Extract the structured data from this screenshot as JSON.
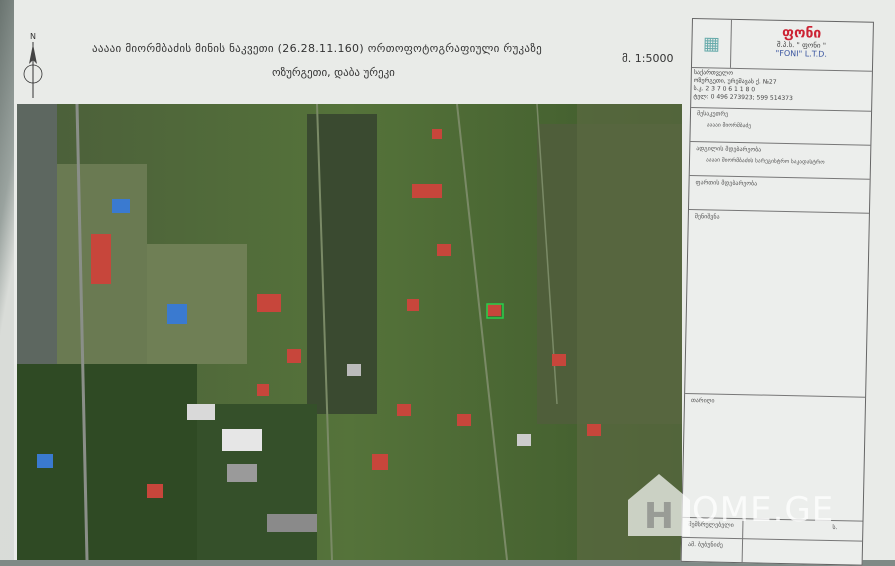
{
  "document": {
    "title": "ააააი მიორმბაძის მინის ნაკვეთი (26.28.11.160) ორთოფოტოგრაფიული რუკაზე",
    "subtitle": "ოზურგეთი, დაბა ურეკი",
    "scale": "მ. 1:5000"
  },
  "stamp": {
    "company_name": "ფონი",
    "company_sub": "შ.პ.ს. \" ფონი \"",
    "company_latin": "\"FONI\" L.T.D.",
    "address_label": "საქართველო",
    "address_line": "ოზურგეთი, ურეშავას ქ. №27",
    "id_line": "ს.კ.   2 3 7 0 6 1 1 8 0",
    "phone_line": "ტელ: 0 496 273923;  599 514373",
    "field_owner_label": "მესაკუთრე",
    "field_owner_value": "ააააი მიორმბაძე",
    "field_address_label": "ადგილის მდებარეობა",
    "field_address_value": "ააააი მიორმბაძის სარეგისტრო საკადასტრო",
    "field_area_label": "ფართის მდებარეობა",
    "field_notes_label": "შენიშვნა",
    "field_date_label": "თარიღი",
    "foot_row1_label": "შემსრულებელი",
    "foot_row1_value": "ს.",
    "foot_row2_label": "ამ. ბუბუნიძე"
  },
  "watermark": {
    "text": "OME.GE"
  }
}
